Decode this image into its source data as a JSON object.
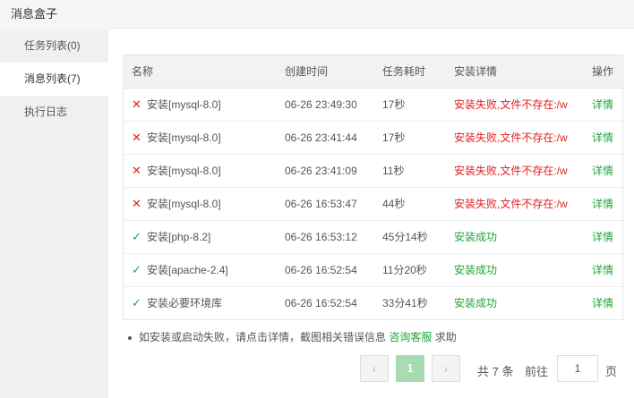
{
  "window": {
    "title": "消息盒子"
  },
  "sidebar": {
    "items": [
      {
        "label": "任务列表(0)"
      },
      {
        "label": "消息列表(7)"
      },
      {
        "label": "执行日志"
      }
    ]
  },
  "table": {
    "headers": {
      "name": "名称",
      "time": "创建时间",
      "duration": "任务耗时",
      "detail": "安装详情",
      "op": "操作"
    },
    "rows": [
      {
        "status": "fail",
        "status_icon": "✕",
        "name": "安装[mysql-8.0]",
        "time": "06-26 23:49:30",
        "duration": "17秒",
        "detail": "安装失败,文件不存在:/w",
        "op": "详情"
      },
      {
        "status": "fail",
        "status_icon": "✕",
        "name": "安装[mysql-8.0]",
        "time": "06-26 23:41:44",
        "duration": "17秒",
        "detail": "安装失败,文件不存在:/w",
        "op": "详情"
      },
      {
        "status": "fail",
        "status_icon": "✕",
        "name": "安装[mysql-8.0]",
        "time": "06-26 23:41:09",
        "duration": "11秒",
        "detail": "安装失败,文件不存在:/w",
        "op": "详情"
      },
      {
        "status": "fail",
        "status_icon": "✕",
        "name": "安装[mysql-8.0]",
        "time": "06-26 16:53:47",
        "duration": "44秒",
        "detail": "安装失败,文件不存在:/w",
        "op": "详情"
      },
      {
        "status": "ok",
        "status_icon": "✓",
        "name": "安装[php-8.2]",
        "time": "06-26 16:53:12",
        "duration": "45分14秒",
        "detail": "安装成功",
        "op": "详情"
      },
      {
        "status": "ok",
        "status_icon": "✓",
        "name": "安装[apache-2.4]",
        "time": "06-26 16:52:54",
        "duration": "11分20秒",
        "detail": "安装成功",
        "op": "详情"
      },
      {
        "status": "ok",
        "status_icon": "✓",
        "name": "安装必要环境库",
        "time": "06-26 16:52:54",
        "duration": "33分41秒",
        "detail": "安装成功",
        "op": "详情"
      }
    ]
  },
  "note": {
    "text": "如安装或启动失败，请点击详情，截图相关错误信息",
    "link": "咨询客服",
    "suffix": "求助"
  },
  "pagination": {
    "prev": "‹",
    "current_page": "1",
    "next": "›",
    "total_text": "共 7 条",
    "goto_label": "前往",
    "goto_value": "1",
    "page_unit": "页"
  },
  "colors": {
    "fail": "#e02020",
    "success": "#20a53a",
    "active_page": "#a8dbb2"
  }
}
